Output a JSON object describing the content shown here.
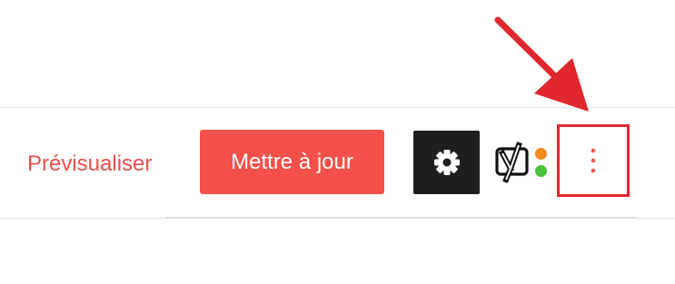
{
  "toolbar": {
    "preview_label": "Prévisualiser",
    "update_label": "Mettre à jour",
    "settings_icon": "gear-icon",
    "yoast_icon": "yoast-logo-icon",
    "more_icon": "vertical-ellipsis-icon"
  },
  "colors": {
    "accent": "#f55049",
    "preview_text": "#ea4f4a",
    "settings_bg": "#1e1e1e",
    "highlight": "#e0272d",
    "yoast_orange": "#f28a1c",
    "yoast_green": "#4cc13b"
  }
}
